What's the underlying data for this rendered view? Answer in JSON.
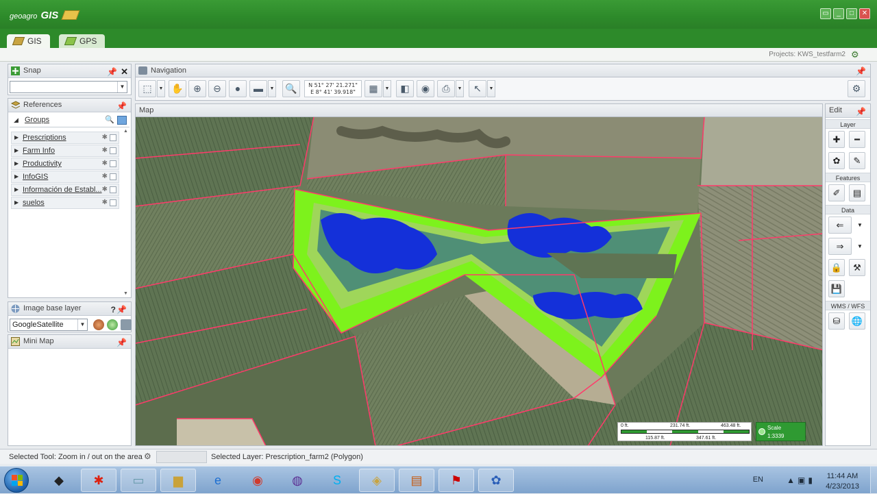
{
  "app": {
    "logo_prefix": "geoagro",
    "logo_name": "GIS"
  },
  "tabs": [
    {
      "label": "GIS"
    },
    {
      "label": "GPS"
    }
  ],
  "project": {
    "label": "Projects: KWS_testfarm2"
  },
  "snap": {
    "title": "Snap",
    "value": ""
  },
  "references": {
    "title": "References",
    "groups_label": "Groups",
    "items": [
      {
        "label": "Prescriptions"
      },
      {
        "label": "Farm Info"
      },
      {
        "label": "Productivity"
      },
      {
        "label": "InfoGIS"
      },
      {
        "label": "Información de Establ..."
      },
      {
        "label": "suelos"
      }
    ]
  },
  "image_base_layer": {
    "title": "Image base layer",
    "help": "?",
    "selected": "GoogleSatellite"
  },
  "mini_map": {
    "title": "Mini Map"
  },
  "navigation": {
    "title": "Navigation",
    "coord_n": "N 51° 27' 21.271\"",
    "coord_e": "E 8° 41' 39.918\""
  },
  "map": {
    "title": "Map",
    "scale": {
      "top_labels": [
        "0 ft.",
        "231.74 ft.",
        "463.48 ft."
      ],
      "bottom_labels": [
        "115.87 ft.",
        "347.61 ft."
      ],
      "badge_title": "Scale",
      "badge_value": "1:3339"
    }
  },
  "edit": {
    "title": "Edit",
    "sections": [
      "Layer",
      "Features",
      "Data",
      "WMS / WFS"
    ]
  },
  "status": {
    "selected_tool": "Selected Tool: Zoom in / out on the area",
    "selected_layer": "Selected Layer: Prescription_farm2 (Polygon)"
  },
  "taskbar": {
    "lang": "EN",
    "time": "11:44 AM",
    "date": "4/23/2013"
  },
  "colors": {
    "brand_green": "#2d8a2a",
    "zone_lime": "#7df21c",
    "zone_light": "#9fd65a",
    "zone_teal": "#4f8f76",
    "zone_blue": "#1430d9",
    "parcel_line": "#ff3a6a"
  }
}
